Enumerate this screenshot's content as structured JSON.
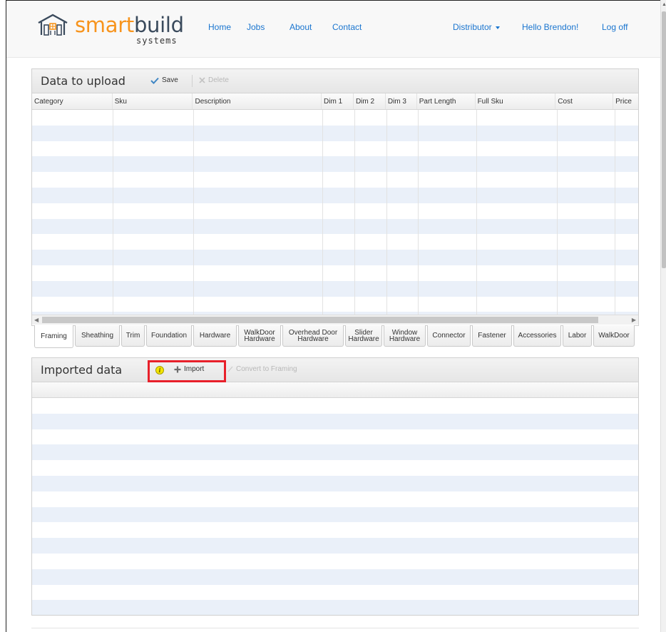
{
  "brand": {
    "smart": "smart",
    "build": "build",
    "sub": "systems"
  },
  "nav": {
    "home": "Home",
    "jobs": "Jobs",
    "about": "About",
    "contact": "Contact",
    "distributor": "Distributor",
    "greeting": "Hello Brendon!",
    "logoff": "Log off"
  },
  "upload_panel": {
    "title": "Data to upload",
    "save": "Save",
    "delete": "Delete",
    "columns": [
      "Category",
      "Sku",
      "Description",
      "Dim 1",
      "Dim 2",
      "Dim 3",
      "Part Length",
      "Full Sku",
      "Cost",
      "Price"
    ]
  },
  "category_tabs": [
    "Framing",
    "Sheathing",
    "Trim",
    "Foundation",
    "Hardware",
    "WalkDoor\nHardware",
    "Overhead Door\nHardware",
    "Slider\nHardware",
    "Window\nHardware",
    "Connector",
    "Fastener",
    "Accessories",
    "Labor",
    "WalkDoor"
  ],
  "active_tab": "Framing",
  "imported_panel": {
    "title": "Imported data",
    "info": "i",
    "import": "Import",
    "convert": "Convert to Framing"
  },
  "colors": {
    "brand_orange": "#f7941d",
    "brand_dark": "#3a4a5c",
    "link_blue": "#1a75cf",
    "highlight_red": "#e8202a",
    "row_alt": "#eaf0f9"
  }
}
